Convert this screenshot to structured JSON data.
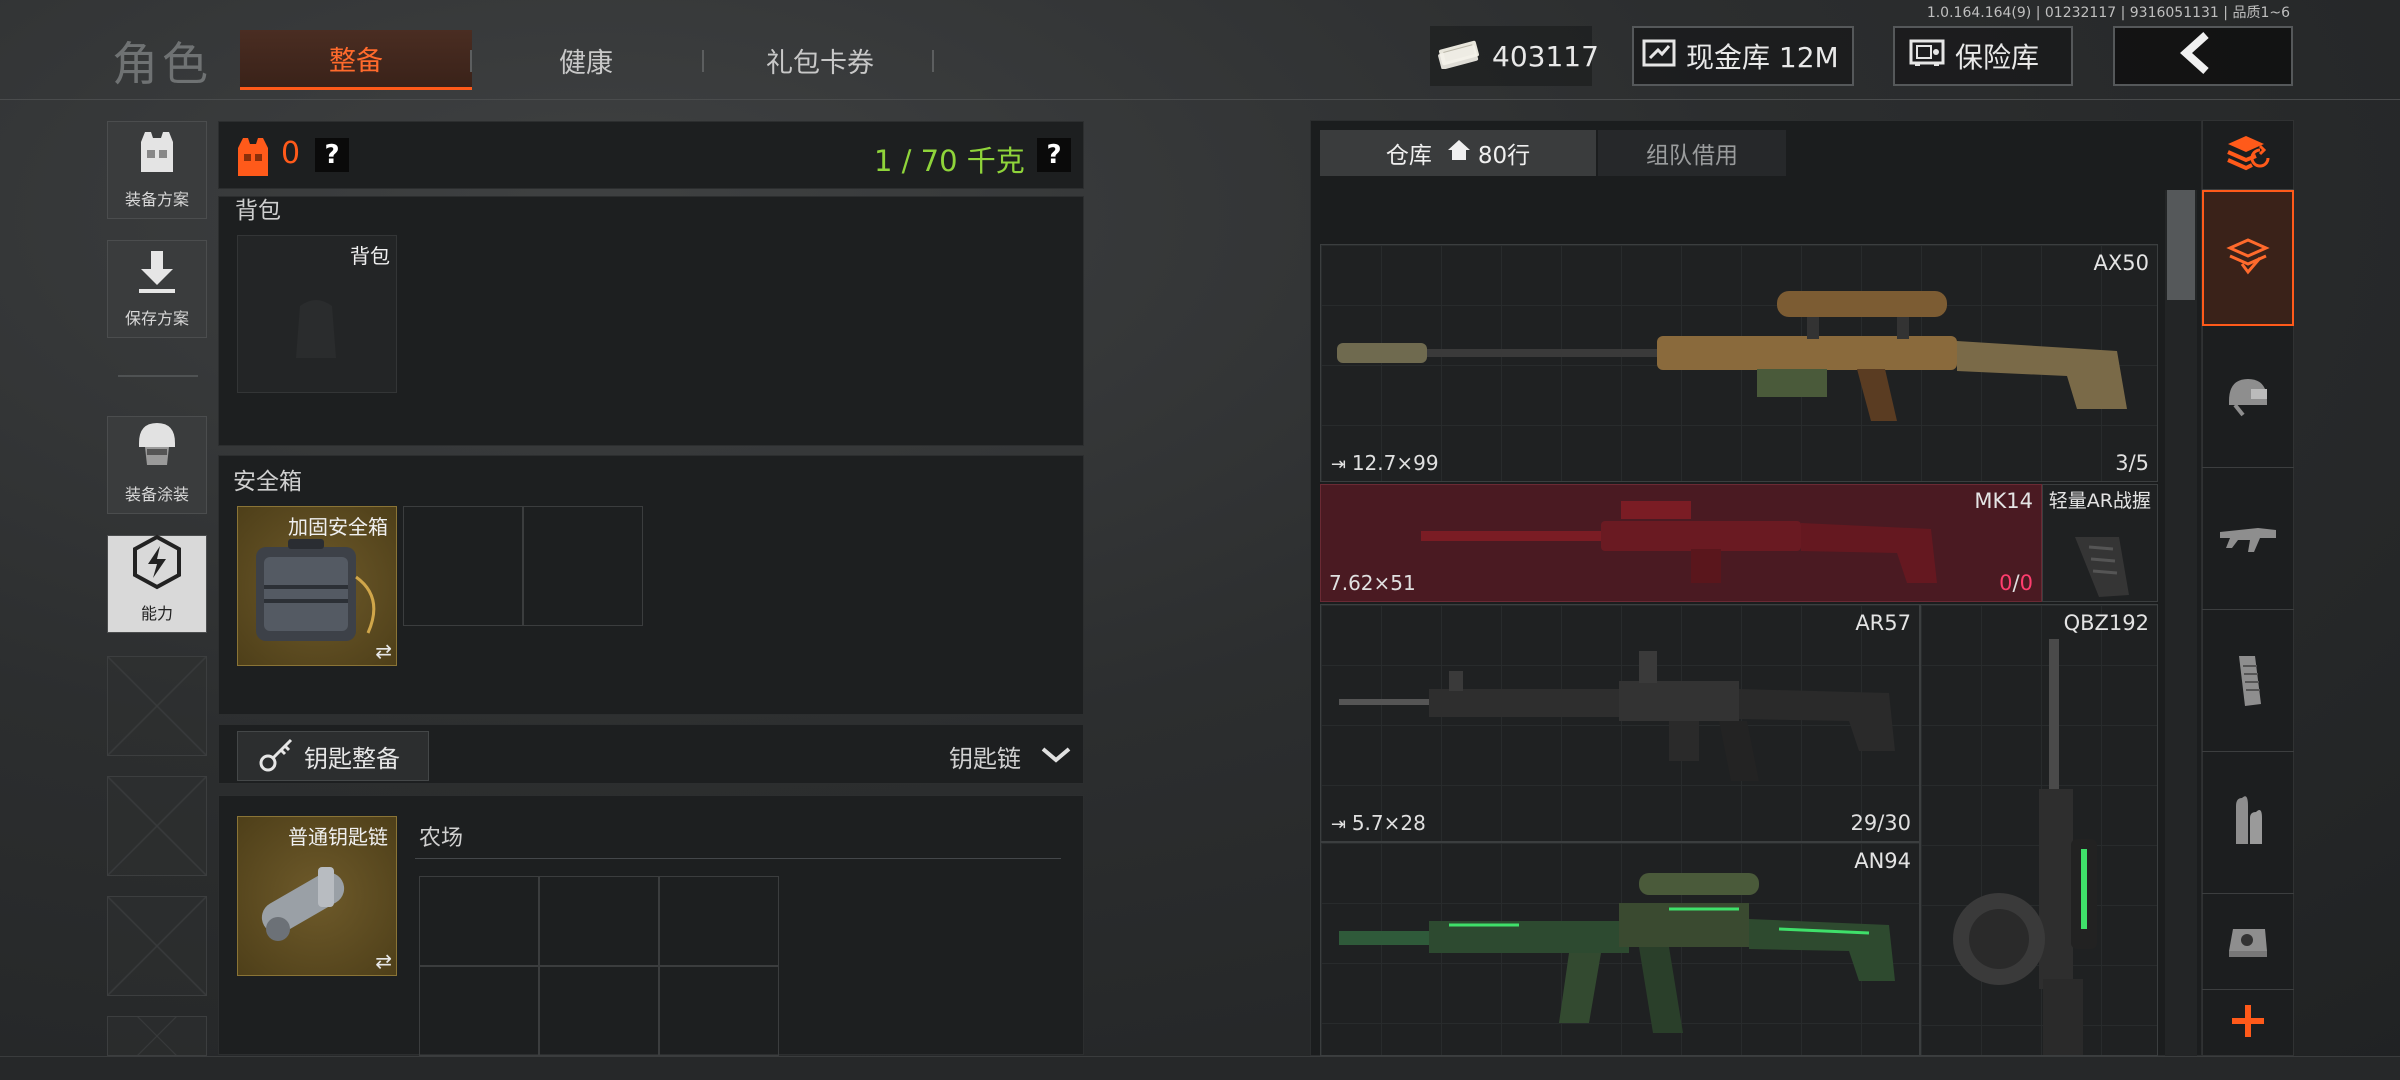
{
  "version": "1.0.164.164(9) | 01232117 | 9316051131 | 品质1~6",
  "header": {
    "title": "角色",
    "tabs": [
      {
        "label": "整备",
        "active": true
      },
      {
        "label": "健康",
        "active": false
      },
      {
        "label": "礼包卡券",
        "active": false
      }
    ],
    "currency": "403117",
    "cash_vault": "现金库 12M",
    "vault": "保险库"
  },
  "rail": {
    "items": [
      {
        "label": "装备方案"
      },
      {
        "label": "保存方案"
      },
      {
        "label": "装备涂装"
      },
      {
        "label": "能力",
        "active": true
      }
    ]
  },
  "equip": {
    "armor_count": "0",
    "weight": "1 / 70 千克",
    "help": "?",
    "backpack_section": "背包",
    "backpack_slot": "背包",
    "safe_section": "安全箱",
    "safe_slot": "加固安全箱",
    "key_button": "钥匙整备",
    "keychain_label": "钥匙链",
    "key_slot": "普通钥匙链",
    "key_location": "农场"
  },
  "storage": {
    "tabs": [
      {
        "label": "仓库",
        "extra": "80行",
        "active": true
      },
      {
        "label": "组队借用",
        "active": false
      }
    ],
    "items": [
      {
        "name": "AX50",
        "caliber": "12.7×99",
        "ammo": "3/5"
      },
      {
        "name": "MK14",
        "caliber": "7.62×51",
        "ammo_loaded": "0",
        "ammo_sep": "/",
        "ammo_total": "0"
      },
      {
        "name": "轻量AR战握"
      },
      {
        "name": "AR57",
        "caliber": "5.7×28",
        "ammo": "29/30"
      },
      {
        "name": "QBZ192"
      },
      {
        "name": "AN94"
      }
    ]
  },
  "colors": {
    "accent": "#ff5a1a",
    "weight_green": "#8fd43a",
    "mk14_red": "#5a1a22",
    "ammo_pink": "#ff3d6e"
  },
  "side_tabs": [
    "layers-refresh-icon",
    "inventory-icon",
    "helmet-icon",
    "rifle-icon",
    "magazine-icon",
    "ammo-icon",
    "sight-icon",
    "plus-icon"
  ]
}
